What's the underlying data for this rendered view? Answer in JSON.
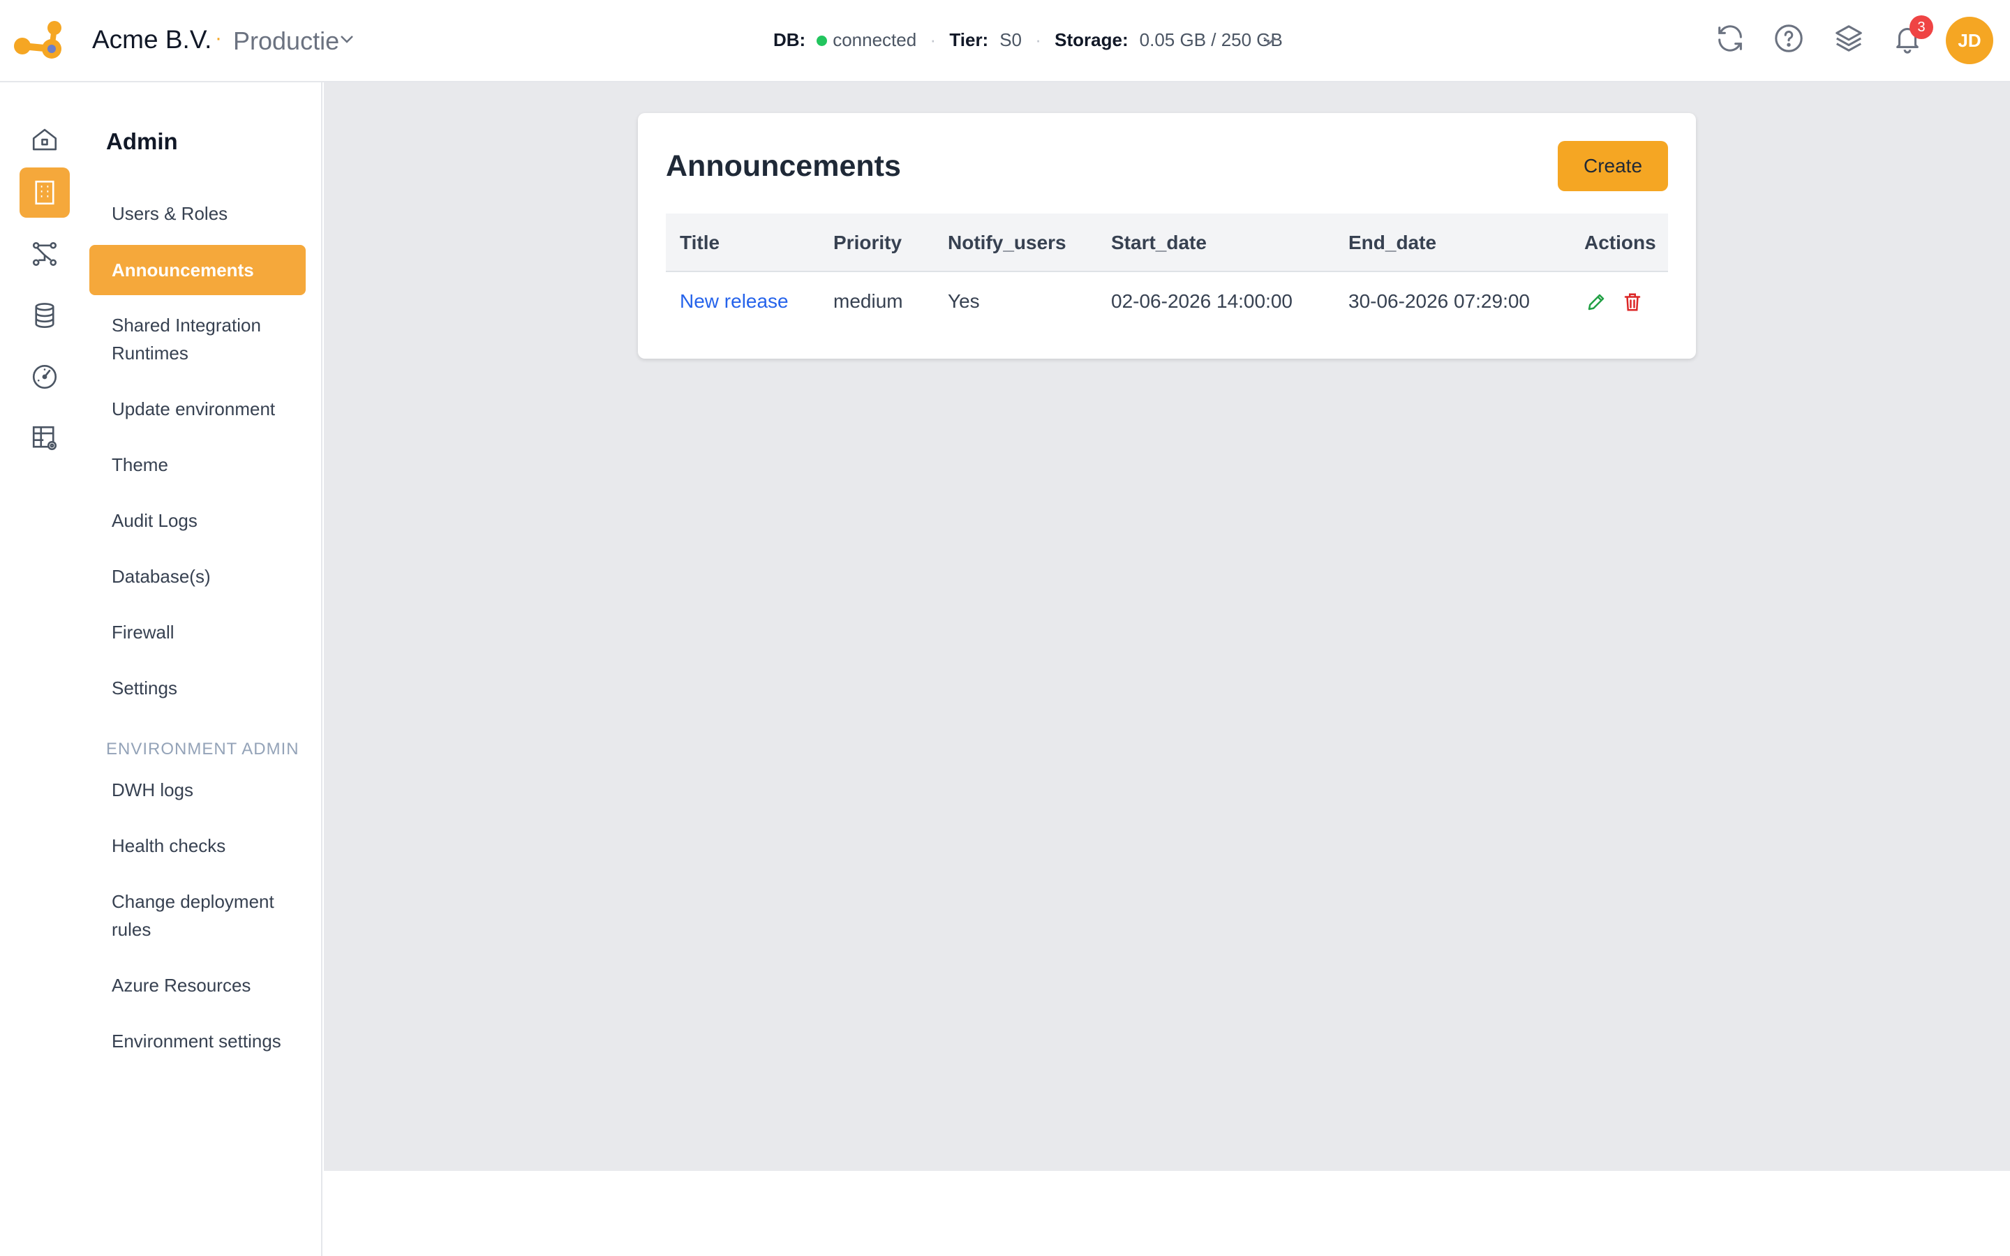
{
  "header": {
    "org_name": "Acme B.V.",
    "env_separator": "·",
    "env_name": "Productie",
    "status": {
      "db_label": "DB:",
      "db_value": "connected",
      "tier_label": "Tier:",
      "tier_value": "S0",
      "storage_label": "Storage:",
      "storage_value": "0.05 GB / 250 GB",
      "separator": "·"
    },
    "notification_count": "3",
    "avatar_initials": "JD"
  },
  "rail": {
    "items": [
      {
        "icon": "home-icon"
      },
      {
        "icon": "building-icon",
        "active": true
      },
      {
        "icon": "pipeline-icon"
      },
      {
        "icon": "database-icon"
      },
      {
        "icon": "gauge-icon"
      },
      {
        "icon": "table-settings-icon"
      }
    ]
  },
  "subnav": {
    "title": "Admin",
    "items": [
      {
        "label": "Users & Roles"
      },
      {
        "label": "Announcements",
        "active": true
      },
      {
        "label": "Shared Integration Runtimes"
      },
      {
        "label": "Update environment"
      },
      {
        "label": "Theme"
      },
      {
        "label": "Audit Logs"
      },
      {
        "label": "Database(s)"
      },
      {
        "label": "Firewall"
      },
      {
        "label": "Settings"
      }
    ],
    "section_label": "ENVIRONMENT ADMIN",
    "env_items": [
      {
        "label": "DWH logs"
      },
      {
        "label": "Health checks"
      },
      {
        "label": "Change deployment rules"
      },
      {
        "label": "Azure Resources"
      },
      {
        "label": "Environment settings"
      }
    ]
  },
  "announcements": {
    "title": "Announcements",
    "create_label": "Create",
    "columns": [
      "Title",
      "Priority",
      "Notify_users",
      "Start_date",
      "End_date",
      "Actions"
    ],
    "rows": [
      {
        "title": "New release",
        "priority": "medium",
        "notify_users": "Yes",
        "start_date": "02-06-2026 14:00:00",
        "end_date": "30-06-2026 07:29:00"
      }
    ]
  },
  "colors": {
    "accent": "#f5a623",
    "link": "#2563eb",
    "edit": "#22a045",
    "delete": "#dc2626",
    "badge": "#ef4444"
  }
}
